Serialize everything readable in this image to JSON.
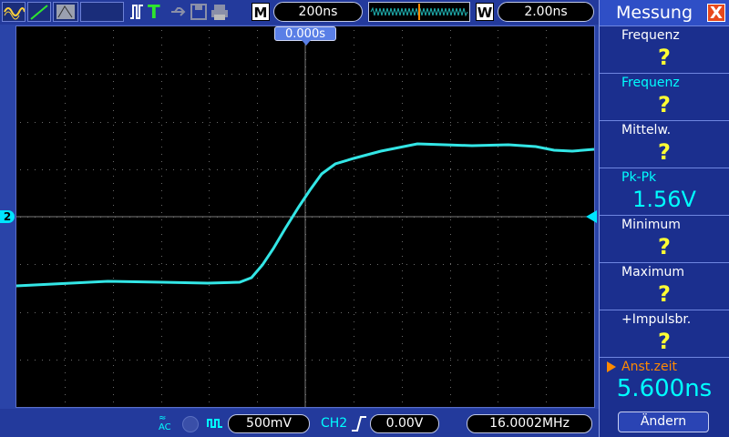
{
  "toolbar": {
    "timebase": "200ns",
    "m_label": "M",
    "w_label": "W",
    "window_value": "2.00ns",
    "trigger_mode_glyph": "T"
  },
  "screen": {
    "trigger_position": "0.000s",
    "channel_marker": "2"
  },
  "bottom": {
    "volts_div": "500mV",
    "trigger_channel": "CH2",
    "trigger_level": "0.00V",
    "frequency": "16.0002MHz"
  },
  "panel": {
    "title": "Messung",
    "close": "X",
    "items": [
      {
        "label": "Frequenz",
        "value": "?"
      },
      {
        "label": "Frequenz",
        "value": "?"
      },
      {
        "label": "Mittelw.",
        "value": "?"
      },
      {
        "label": "Pk-Pk",
        "value": "1.56V"
      },
      {
        "label": "Minimum",
        "value": "?"
      },
      {
        "label": "Maximum",
        "value": "?"
      },
      {
        "label": "+Impulsbr.",
        "value": "?"
      },
      {
        "label": "Anst.zeit",
        "value": "5.600ns"
      }
    ],
    "button": "Ändern"
  },
  "colors": {
    "trace": "#33e6e6",
    "panel_bg": "#1b2f8e",
    "accent": "#ff8a00",
    "question": "#ffff33"
  }
}
